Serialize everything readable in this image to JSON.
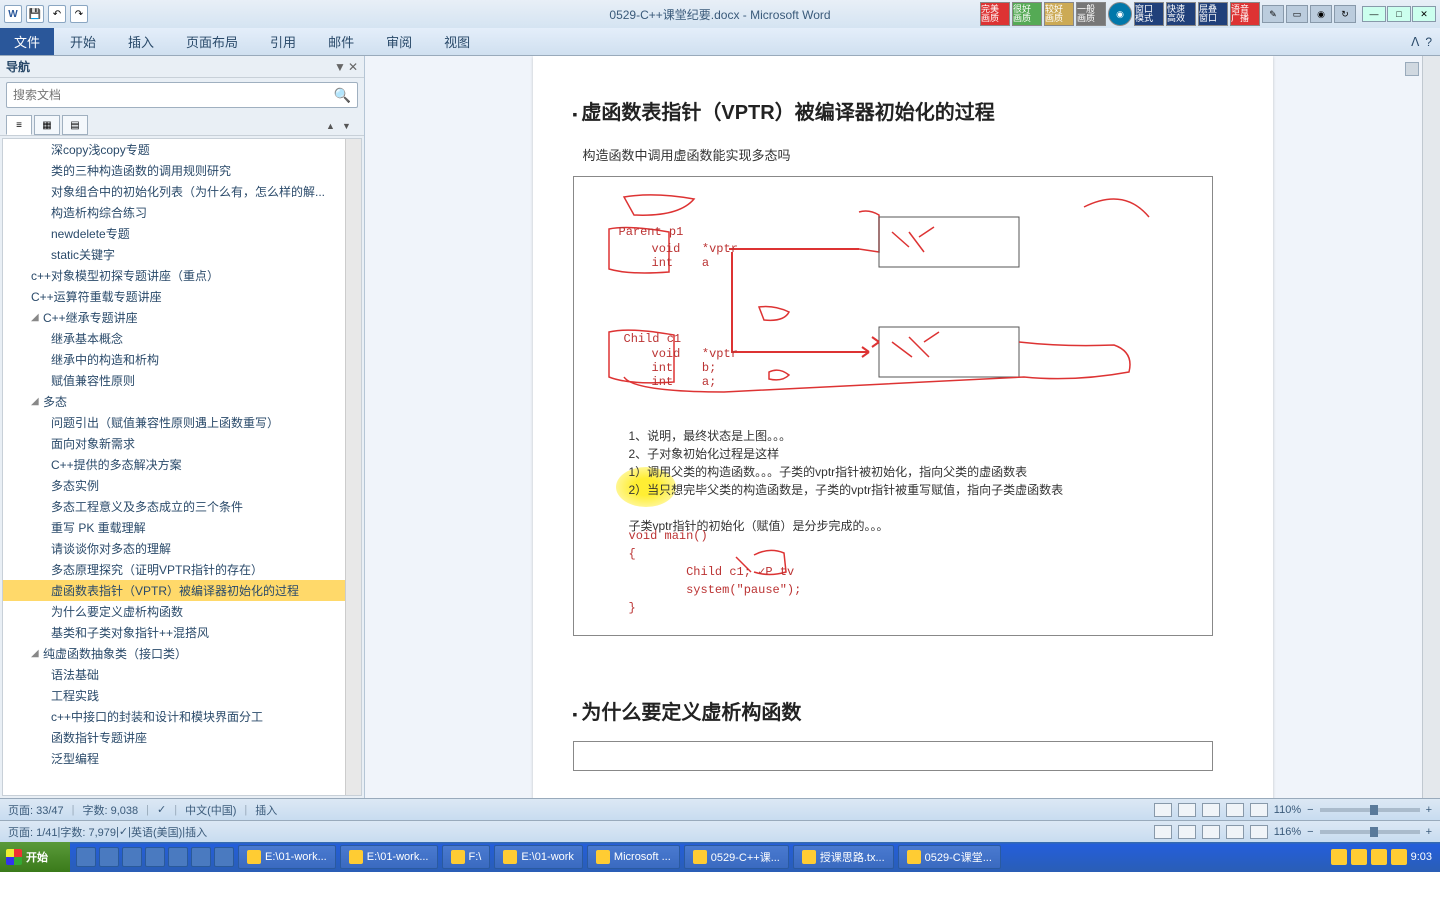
{
  "titlebar": {
    "doc_title": "0529-C++课堂纪要.docx - Microsoft Word"
  },
  "quality_buttons": [
    "完美\n画质",
    "很好\n画质",
    "较好\n画质",
    "一般\n画质",
    "窗口\n模式",
    "快速\n高效",
    "层叠\n窗口",
    "语音\n广播"
  ],
  "ribbon": {
    "file": "文件",
    "tabs": [
      "开始",
      "插入",
      "页面布局",
      "引用",
      "邮件",
      "审阅",
      "视图"
    ]
  },
  "nav": {
    "title": "导航",
    "search_placeholder": "搜索文档",
    "items": [
      {
        "lv": 2,
        "t": "深copy浅copy专题"
      },
      {
        "lv": 2,
        "t": "类的三种构造函数的调用规则研究"
      },
      {
        "lv": 2,
        "t": "对象组合中的初始化列表（为什么有，怎么样的解..."
      },
      {
        "lv": 2,
        "t": "构造析构综合练习"
      },
      {
        "lv": 2,
        "t": "newdelete专题"
      },
      {
        "lv": 2,
        "t": "static关键字"
      },
      {
        "lv": 1,
        "t": "c++对象模型初探专题讲座（重点）"
      },
      {
        "lv": 1,
        "t": "C++运算符重载专题讲座"
      },
      {
        "lv": 1,
        "t": "C++继承专题讲座",
        "tree": "◢"
      },
      {
        "lv": 2,
        "t": "继承基本概念"
      },
      {
        "lv": 2,
        "t": "继承中的构造和析构"
      },
      {
        "lv": 2,
        "t": "赋值兼容性原则"
      },
      {
        "lv": 1,
        "t": "多态",
        "tree": "◢"
      },
      {
        "lv": 2,
        "t": "问题引出（赋值兼容性原则遇上函数重写）"
      },
      {
        "lv": 2,
        "t": "面向对象新需求"
      },
      {
        "lv": 2,
        "t": "C++提供的多态解决方案"
      },
      {
        "lv": 2,
        "t": "多态实例"
      },
      {
        "lv": 2,
        "t": "多态工程意义及多态成立的三个条件"
      },
      {
        "lv": 2,
        "t": "重写 PK 重载理解"
      },
      {
        "lv": 2,
        "t": "请谈谈你对多态的理解"
      },
      {
        "lv": 2,
        "t": "多态原理探究（证明VPTR指针的存在）"
      },
      {
        "lv": 2,
        "t": "虚函数表指针（VPTR）被编译器初始化的过程",
        "sel": true
      },
      {
        "lv": 2,
        "t": "为什么要定义虚析构函数"
      },
      {
        "lv": 2,
        "t": "基类和子类对象指针++混搭风"
      },
      {
        "lv": 1,
        "t": "纯虚函数抽象类（接口类）",
        "tree": "◢"
      },
      {
        "lv": 2,
        "t": "语法基础"
      },
      {
        "lv": 2,
        "t": "工程实践"
      },
      {
        "lv": 2,
        "t": "c++中接口的封装和设计和模块界面分工"
      },
      {
        "lv": 2,
        "t": "函数指针专题讲座"
      },
      {
        "lv": 2,
        "t": "泛型编程"
      }
    ]
  },
  "doc": {
    "h1": "虚函数表指针（VPTR）被编译器初始化的过程",
    "sub1": "构造函数中调用虚函数能实现多态吗",
    "parent_label": "Parent p1",
    "parent_fields": "void   *vptr\nint    a",
    "child_label": "Child c1",
    "child_fields": "void   *vptr\nint    b;\nint    a;",
    "explain1": "1、说明，最终状态是上图。。。",
    "explain2": "2、子对象初始化过程是这样",
    "explain3": "1）调用父类的构造函数。。。子类的vptr指针被初始化，指向父类的虚函数表",
    "explain4": "2）当只想完毕父类的构造函数是，子类的vptr指针被重写赋值，指向子类虚函数表",
    "explain5": "子类vptr指针的初始化（赋值）是分步完成的。。。",
    "code": "void main()\n{\n        Child c1; ✓P tv\n        system(\"pause\");\n}",
    "h2": "为什么要定义虚析构函数"
  },
  "status1": {
    "page": "页面: 33/47",
    "words": "字数: 9,038",
    "lang": "中文(中国)",
    "mode": "插入",
    "zoom": "110%"
  },
  "status2": {
    "page": "页面: 1/41",
    "words": "字数: 7,979",
    "lang": "英语(美国)",
    "mode": "插入",
    "zoom": "116%"
  },
  "taskbar": {
    "start": "开始",
    "tasks": [
      "E:\\01-work...",
      "E:\\01-work...",
      "F:\\",
      "E:\\01-work",
      "Microsoft ...",
      "0529-C++课...",
      "授课思路.tx...",
      "0529-C课堂..."
    ],
    "clock": "9:03"
  }
}
